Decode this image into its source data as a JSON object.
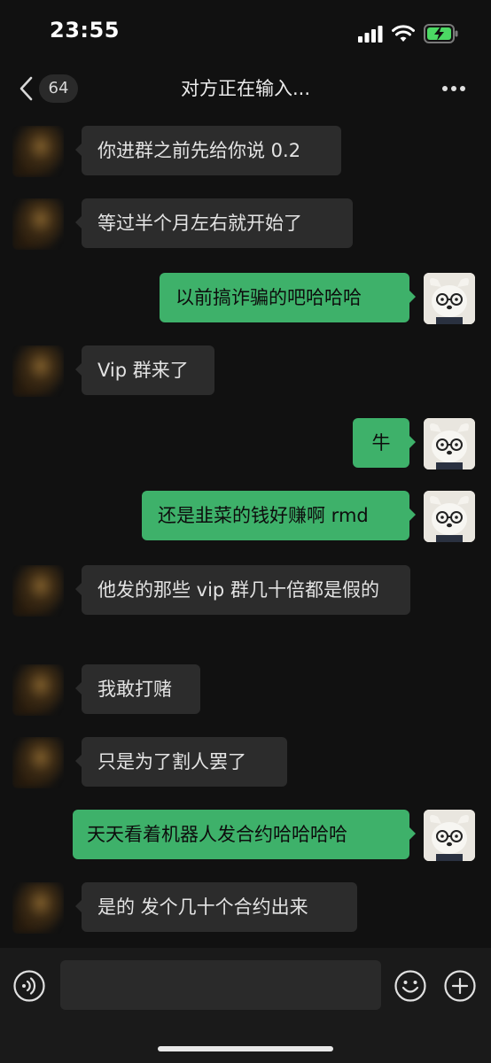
{
  "status_bar": {
    "time": "23:55"
  },
  "header": {
    "back_icon": "chevron-left-icon",
    "unread_count": "64",
    "title": "对方正在输入...",
    "more_icon": "more-horizontal-icon"
  },
  "messages": [
    {
      "side": "in",
      "text": "你进群之前先给你说 0.2"
    },
    {
      "side": "in",
      "text": "等过半个月左右就开始了"
    },
    {
      "side": "out",
      "text": "以前搞诈骗的吧哈哈哈"
    },
    {
      "side": "in",
      "text": "Vip 群来了"
    },
    {
      "side": "out",
      "text": "牛"
    },
    {
      "side": "out",
      "text": "还是韭菜的钱好赚啊 rmd"
    },
    {
      "side": "in",
      "text": "他发的那些 vip 群几十倍都是假的"
    },
    {
      "side": "in",
      "text": "我敢打赌"
    },
    {
      "side": "in",
      "text": "只是为了割人罢了"
    },
    {
      "side": "out",
      "text": "天天看着机器人发合约哈哈哈哈"
    },
    {
      "side": "in",
      "text": "是的 发个几十个合约出来"
    }
  ],
  "input_bar": {
    "voice_icon": "voice-icon",
    "emoji_icon": "emoji-icon",
    "plus_icon": "plus-icon",
    "input_value": ""
  },
  "colors": {
    "background": "#111111",
    "incoming_bubble": "#2c2c2c",
    "outgoing_bubble": "#3eb16a",
    "input_bar": "#1a1a1a"
  }
}
